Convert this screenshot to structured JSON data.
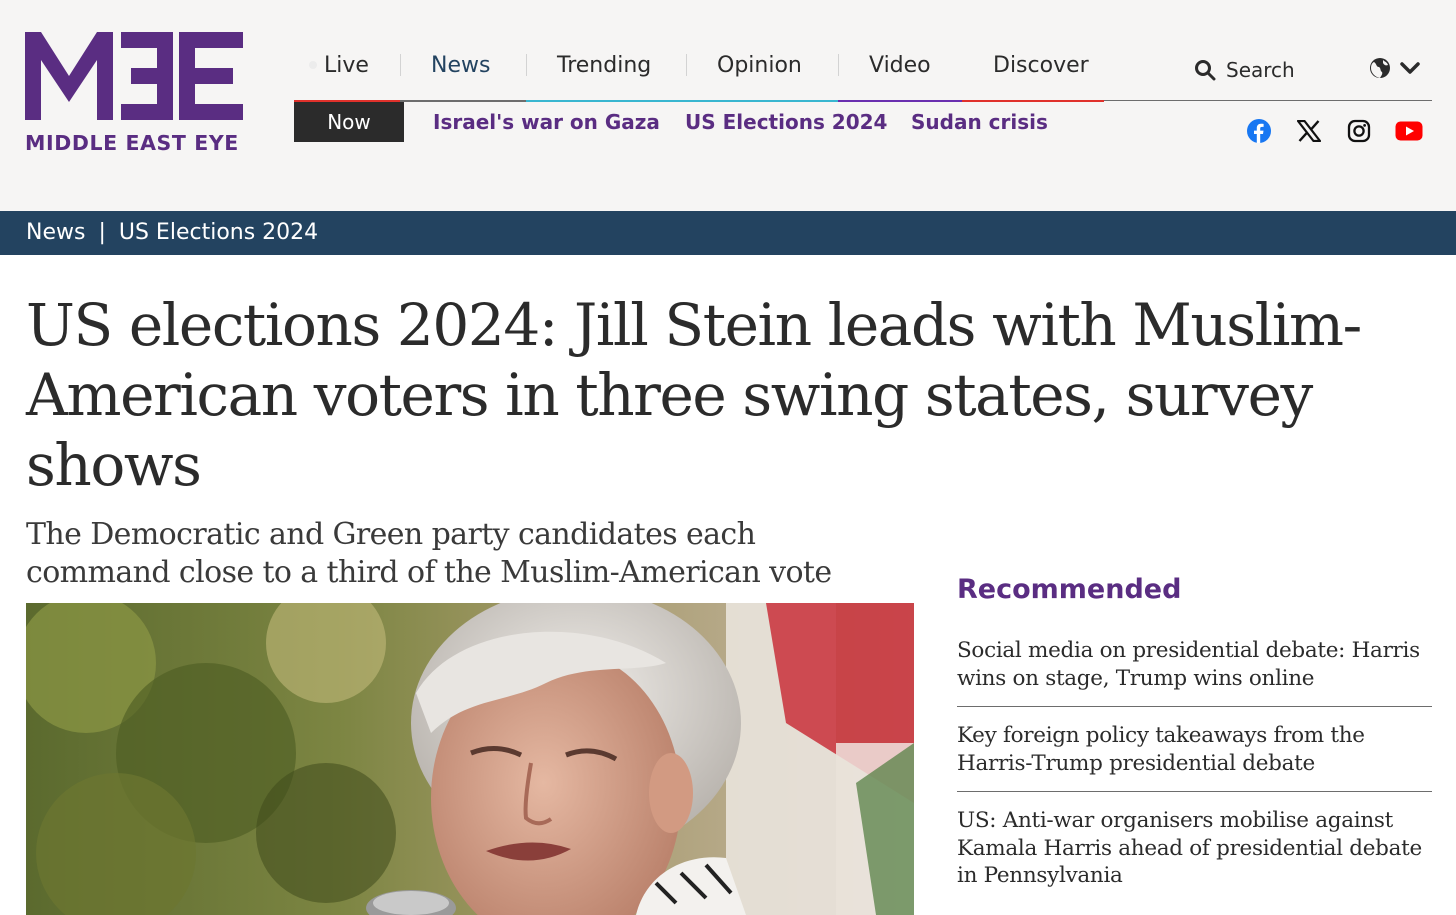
{
  "brand": {
    "logo_mark": "MEE",
    "logo_text": "MIDDLE EAST EYE",
    "color": "#5a2d82"
  },
  "main_nav": [
    {
      "label": "Live",
      "accent": "#e0312b"
    },
    {
      "label": "News",
      "accent": "#234360"
    },
    {
      "label": "Trending",
      "accent": "#39b6d0"
    },
    {
      "label": "Opinion",
      "accent": "#39b6d0"
    },
    {
      "label": "Video",
      "accent": "#6a2fb0"
    },
    {
      "label": "Discover",
      "accent": "#e0312b"
    }
  ],
  "search": {
    "label": "Search",
    "icon": "search-icon"
  },
  "language": {
    "icon": "globe-icon",
    "caret": "chevron-down-icon"
  },
  "sub_nav": {
    "now_label": "Now",
    "links": [
      "Israel's war on Gaza",
      "US Elections 2024",
      "Sudan crisis"
    ]
  },
  "socials": [
    {
      "name": "facebook-icon",
      "color": "#1877f2"
    },
    {
      "name": "x-icon",
      "color": "#111111"
    },
    {
      "name": "instagram-icon",
      "color": "#111111"
    },
    {
      "name": "youtube-icon",
      "color": "#ff0000"
    }
  ],
  "breadcrumb": {
    "section": "News",
    "separator": "|",
    "topic": "US Elections 2024"
  },
  "article": {
    "headline": "US elections 2024: Jill Stein leads with Muslim-American voters in three swing states, survey shows",
    "standfirst": "The Democratic and Green party candidates each command close to a third of the Muslim-American vote"
  },
  "recommended": {
    "title": "Recommended",
    "items": [
      "Social media on presidential debate: Harris wins on stage, Trump wins online",
      "Key foreign policy takeaways from the Harris-Trump presidential debate",
      "US: Anti-war organisers mobilise against Kamala Harris ahead of presidential debate in Pennsylvania"
    ]
  },
  "colors": {
    "header_bg": "#f6f5f4",
    "band_bg": "#234360",
    "text": "#2b2b2b"
  }
}
